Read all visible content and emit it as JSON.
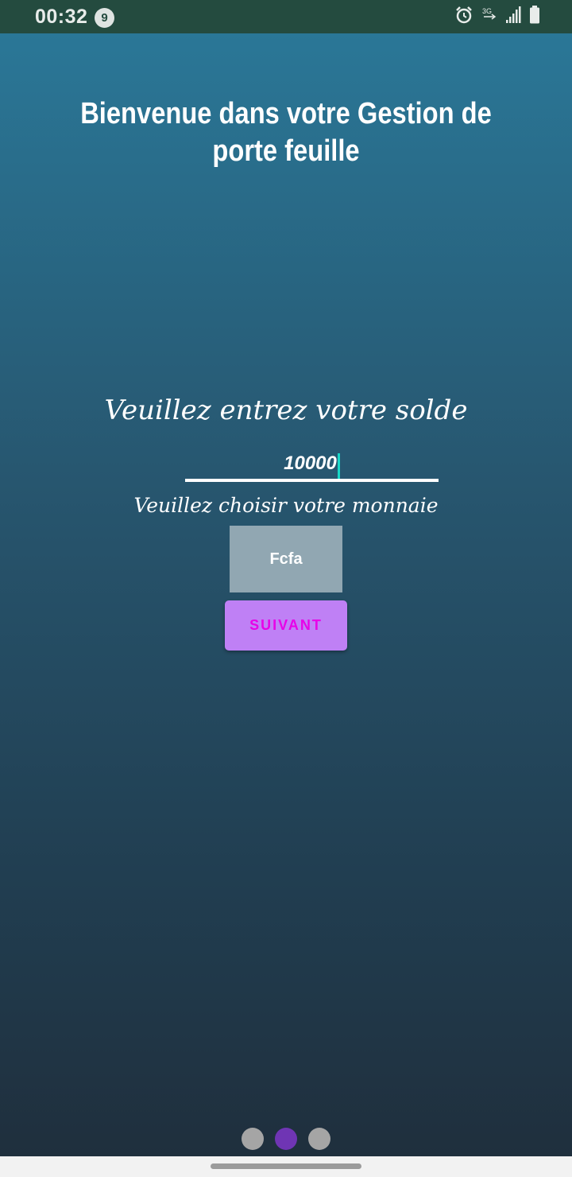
{
  "status_bar": {
    "time": "00:32",
    "notification_count": "9",
    "network_label": "3G",
    "icons": [
      "alarm-icon",
      "network-3g-icon",
      "signal-icon",
      "battery-icon"
    ]
  },
  "welcome": {
    "title": "Bienvenue dans votre Gestion de porte feuille"
  },
  "balance": {
    "prompt": "Veuillez entrez votre solde",
    "value": "10000"
  },
  "currency": {
    "prompt": "Veuillez choisir votre monnaie",
    "selected": "Fcfa"
  },
  "actions": {
    "next_label": "SUIVANT"
  },
  "pager": {
    "page_count": 3,
    "active_page": 2
  },
  "colors": {
    "status_bar": "#244b3f",
    "gradient_top": "#2a7797",
    "gradient_bottom": "#1f2f3d",
    "button_bg": "#bf80f5",
    "button_text": "#e800e8",
    "currency_bg": "#91a7b2",
    "caret": "#19d8c8",
    "active_dot": "#6f35b4",
    "inactive_dot": "#a5a5a5"
  }
}
